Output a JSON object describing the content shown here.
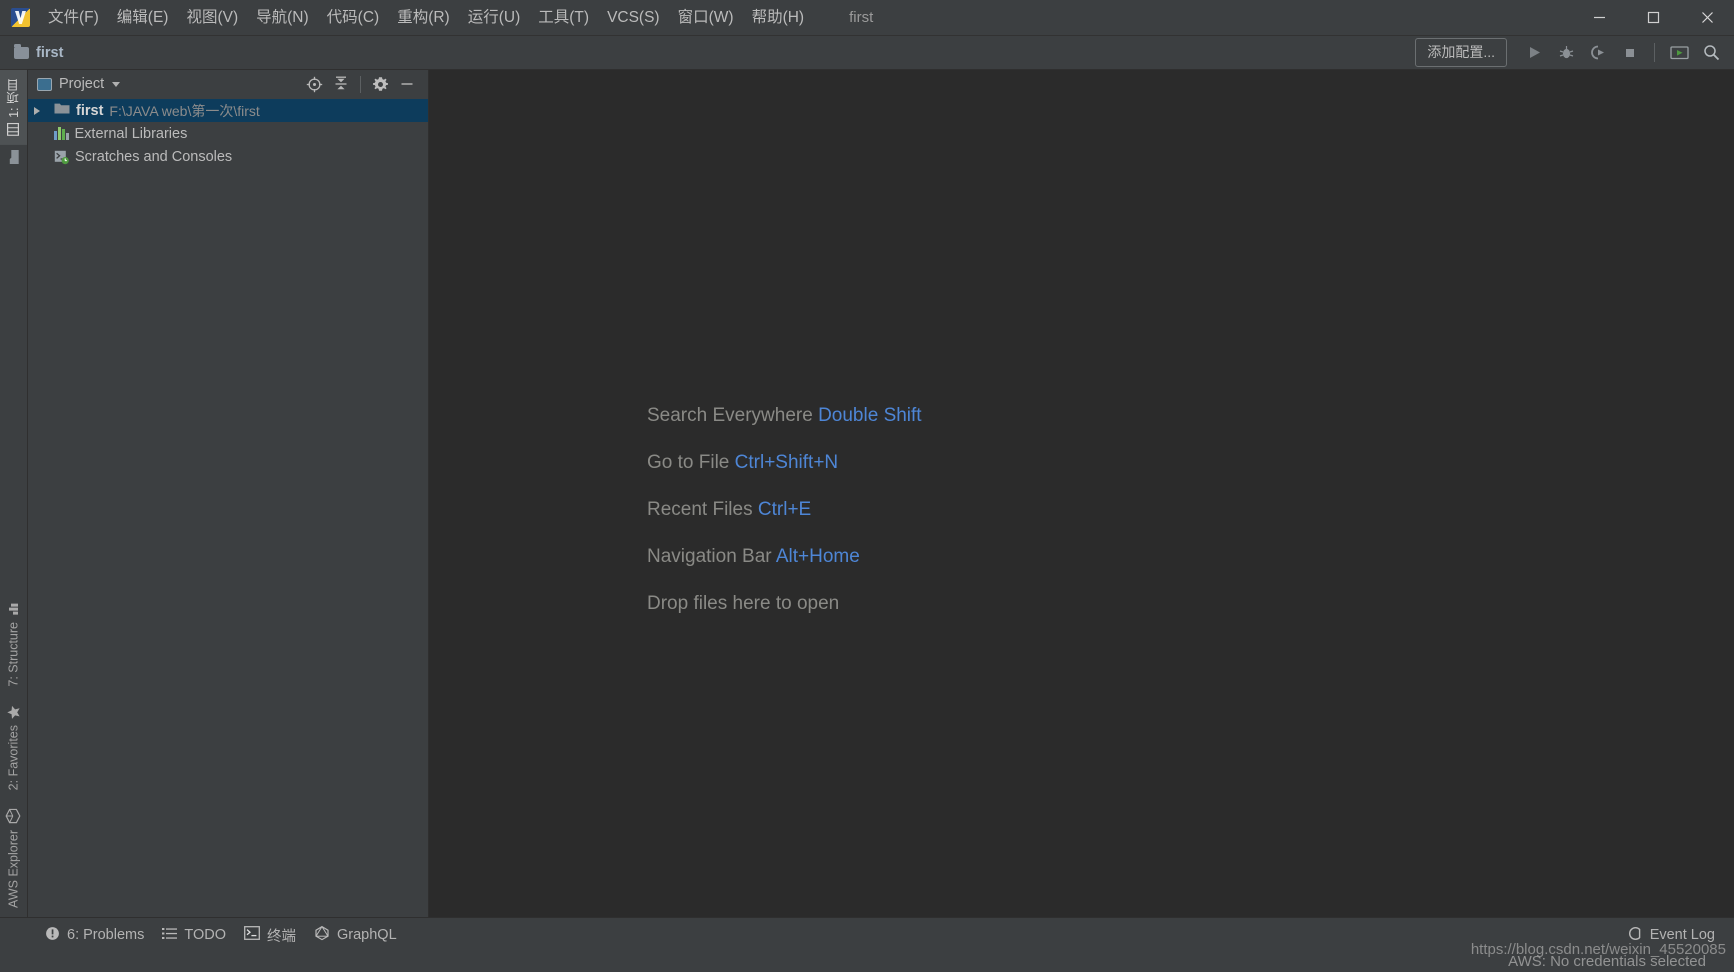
{
  "colors": {
    "panel_bg": "#3c3f41",
    "editor_bg": "#2b2b2b",
    "selection_blue": "#0d3c5c",
    "accent_link": "#4e86d6",
    "text_primary": "#bbbbbb",
    "text_muted": "#8a8a86"
  },
  "titlebar": {
    "logo_icon": "webstorm-logo-icon",
    "project_name": "first",
    "menus": [
      {
        "label": "文件(F)",
        "mnemonic": "F"
      },
      {
        "label": "编辑(E)",
        "mnemonic": "E"
      },
      {
        "label": "视图(V)",
        "mnemonic": "V"
      },
      {
        "label": "导航(N)",
        "mnemonic": "N"
      },
      {
        "label": "代码(C)",
        "mnemonic": "C"
      },
      {
        "label": "重构(R)",
        "mnemonic": "R"
      },
      {
        "label": "运行(U)",
        "mnemonic": "U"
      },
      {
        "label": "工具(T)",
        "mnemonic": "T"
      },
      {
        "label": "VCS(S)",
        "mnemonic": "S"
      },
      {
        "label": "窗口(W)",
        "mnemonic": "W"
      },
      {
        "label": "帮助(H)",
        "mnemonic": "H"
      }
    ],
    "window_controls": [
      {
        "name": "minimize-button",
        "icon": "minimize-icon"
      },
      {
        "name": "maximize-button",
        "icon": "maximize-icon"
      },
      {
        "name": "close-button",
        "icon": "close-icon"
      }
    ]
  },
  "navbar": {
    "breadcrumb": "first",
    "breadcrumb_icon": "folder-icon",
    "add_config_label": "添加配置...",
    "actions": [
      {
        "name": "run-button",
        "icon": "run-triangle-icon"
      },
      {
        "name": "debug-button",
        "icon": "bug-icon"
      },
      {
        "name": "run-with-coverage-button",
        "icon": "coverage-icon"
      },
      {
        "name": "stop-button",
        "icon": "stop-square-icon"
      },
      {
        "name": "select-run-window-button",
        "icon": "run-window-icon"
      },
      {
        "name": "search-button",
        "icon": "search-icon"
      }
    ]
  },
  "left_stripe": {
    "top_tabs": [
      {
        "label": "1: 项目",
        "icon": "project-icon",
        "active": true
      }
    ],
    "bottom_tabs": [
      {
        "label": "7: Structure",
        "icon": "structure-icon",
        "active": false
      },
      {
        "label": "2: Favorites",
        "icon": "star-icon",
        "active": false
      },
      {
        "label": "AWS Explorer",
        "icon": "aws-cube-icon",
        "active": false
      }
    ]
  },
  "project_panel": {
    "title": "Project",
    "title_icon": "project-view-icon",
    "dropdown_icon": "chevron-down-icon",
    "actions": [
      {
        "name": "select-opened-file-button",
        "icon": "locate-target-icon"
      },
      {
        "name": "collapse-all-button",
        "icon": "collapse-all-icon"
      },
      {
        "name": "settings-button",
        "icon": "gear-icon"
      },
      {
        "name": "hide-button",
        "icon": "minimize-icon"
      }
    ],
    "tree": [
      {
        "name": "first",
        "path": "F:\\JAVA web\\第一次\\first",
        "icon": "folder-icon",
        "expander": "chevron-right-icon",
        "selected": true,
        "indent": 0
      },
      {
        "name": "External Libraries",
        "path": "",
        "icon": "libraries-icon",
        "expander": "",
        "selected": false,
        "indent": 1
      },
      {
        "name": "Scratches and Consoles",
        "path": "",
        "icon": "scratches-icon",
        "expander": "",
        "selected": false,
        "indent": 1
      }
    ]
  },
  "editor": {
    "hints": [
      {
        "label": "Search Everywhere",
        "key": "Double Shift"
      },
      {
        "label": "Go to File",
        "key": "Ctrl+Shift+N"
      },
      {
        "label": "Recent Files",
        "key": "Ctrl+E"
      },
      {
        "label": "Navigation Bar",
        "key": "Alt+Home"
      },
      {
        "label": "Drop files here to open",
        "key": ""
      }
    ]
  },
  "statusbar": {
    "items": [
      {
        "label": "6: Problems",
        "icon": "problems-icon",
        "mnemonic": "6"
      },
      {
        "label": "TODO",
        "icon": "todo-list-icon",
        "mnemonic": ""
      },
      {
        "label": "终端",
        "icon": "terminal-icon",
        "mnemonic": ""
      },
      {
        "label": "GraphQL",
        "icon": "graphql-icon",
        "mnemonic": ""
      }
    ],
    "event_log": {
      "label": "Event Log",
      "icon": "event-log-icon"
    },
    "aws_status": "AWS: No credentials selected",
    "watermark": "https://blog.csdn.net/weixin_45520085"
  }
}
